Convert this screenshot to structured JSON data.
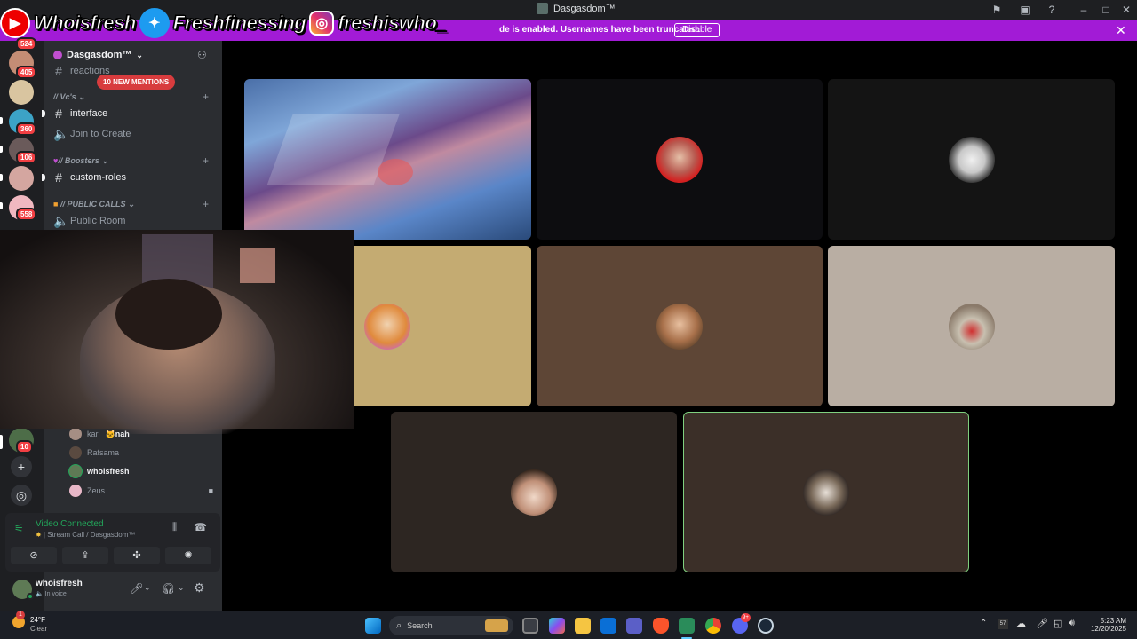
{
  "window": {
    "title": "Dasgasdom™"
  },
  "banner": {
    "message": "de is enabled. Usernames have been truncated.",
    "disable_label": "Disable"
  },
  "overlay": {
    "youtube": "Whoisfresh",
    "twitter": "Freshfinessing",
    "instagram": "freshiswho_"
  },
  "server_rail": {
    "badges": [
      "524",
      "405",
      "360",
      "106",
      "558",
      "10"
    ]
  },
  "guild": {
    "name": "Dasgasdom™"
  },
  "channels": {
    "reactions": "reactions",
    "cat_vcs": "// Vc's",
    "interface": "interface",
    "join_to_create": "Join to Create",
    "cat_boosters": "// Boosters",
    "custom_roles": "custom-roles",
    "cat_public_calls": "// PUBLIC CALLS",
    "public_room": "Public Room"
  },
  "mentions_pill": "10 NEW MENTIONS",
  "voice_members": [
    {
      "name": "kari",
      "tag": "nah"
    },
    {
      "name": "Rafsama"
    },
    {
      "name": "whoisfresh"
    },
    {
      "name": "Zeus"
    }
  ],
  "voice_panel": {
    "state": "Video Connected",
    "sub": "Stream Call / Dasgasdom™"
  },
  "user": {
    "name": "whoisfresh",
    "status": "In voice"
  },
  "taskbar": {
    "temp": "24°F",
    "condition": "Clear",
    "weather_badge": "1",
    "search_placeholder": "Search",
    "time": "5:23 AM",
    "date": "12/20/2025",
    "tray_badge": "57",
    "discord_badge": "9+"
  },
  "colors": {
    "banner": "#a21bd6",
    "connected": "#23a55a",
    "tile_highlight": "#7fd07f"
  }
}
